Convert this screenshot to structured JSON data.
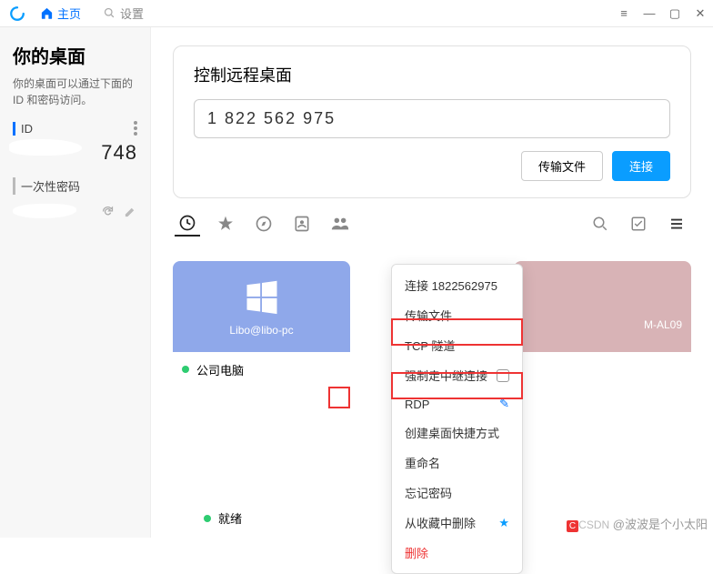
{
  "titlebar": {
    "tabs": {
      "home": "主页",
      "settings": "设置"
    }
  },
  "sidebar": {
    "title": "你的桌面",
    "desc": "你的桌面可以通过下面的 ID 和密码访问。",
    "id_label": "ID",
    "id_partial": "748",
    "pw_label": "一次性密码"
  },
  "panel": {
    "title": "控制远程桌面",
    "id_value": "1 822 562 975",
    "transfer": "传输文件",
    "connect": "连接"
  },
  "cards": {
    "blue": {
      "label": "Libo@libo-pc",
      "name": "公司电脑"
    },
    "pink": {
      "label_suffix": "M-AL09"
    }
  },
  "ctx": {
    "connect": "连接",
    "connect_id": "1822562975",
    "transfer": "传输文件",
    "tcp": "TCP 隧道",
    "relay": "强制走中继连接",
    "rdp": "RDP",
    "shortcut": "创建桌面快捷方式",
    "rename": "重命名",
    "forget": "忘记密码",
    "unfav": "从收藏中删除",
    "delete": "删除"
  },
  "status": {
    "ready": "就绪"
  },
  "watermark": {
    "csdn": "CSDN",
    "author": "@波波是个小太阳"
  }
}
